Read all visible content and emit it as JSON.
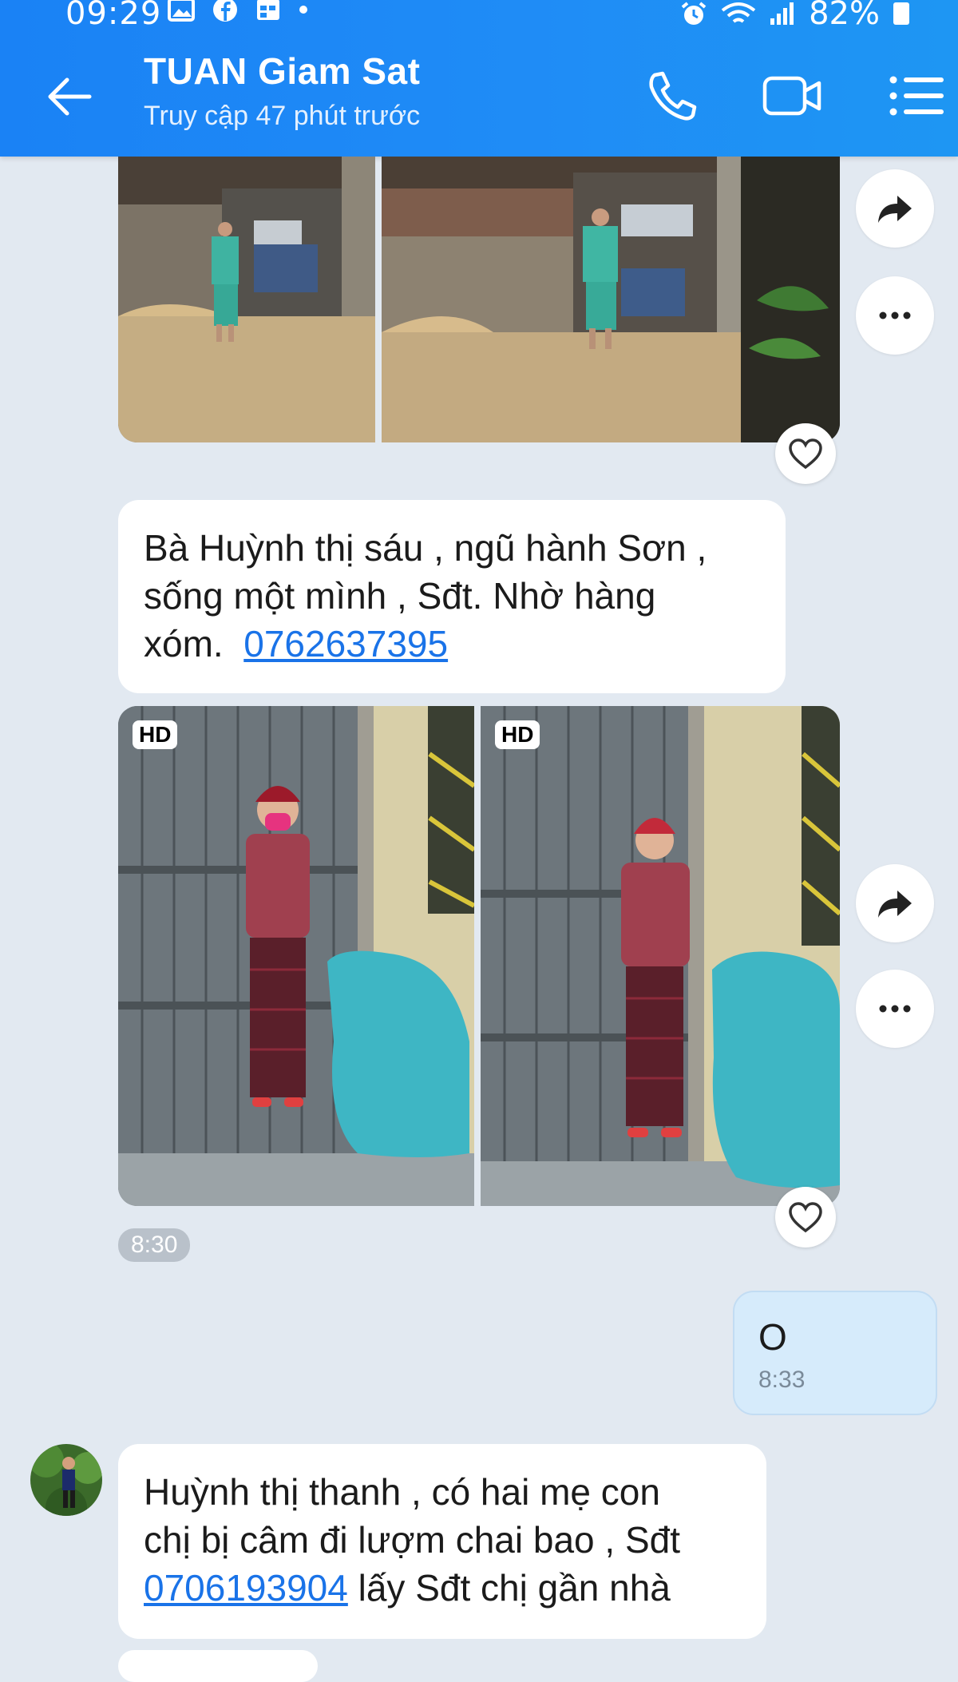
{
  "status_bar": {
    "time": "09:29",
    "battery": "82%"
  },
  "header": {
    "contact_name": "TUAN Giam Sat",
    "last_seen": "Truy cập 47 phút trước"
  },
  "messages": {
    "msg1": {
      "line1": "Bà Huỳnh thị sáu , ngũ hành Sơn  ,",
      "line2": "sống một mình , Sđt. Nhờ hàng",
      "line3_prefix": "xóm.  ",
      "phone": "0762637395"
    },
    "media2": {
      "hd_label_1": "HD",
      "hd_label_2": "HD",
      "time": "8:30"
    },
    "outgoing": {
      "text": "O",
      "time": "8:33"
    },
    "msg3": {
      "line1": "Huỳnh thị thanh , có hai mẹ con",
      "line2": "chị bị câm đi lượm chai bao , Sđt",
      "phone": "0706193904",
      "line3_suffix": " lấy Sđt chị gần nhà"
    }
  },
  "icons": {
    "back": "arrow-left-icon",
    "call": "phone-icon",
    "video": "video-camera-icon",
    "menu": "list-menu-icon",
    "share": "share-arrow-icon",
    "more": "more-dots-icon",
    "heart": "heart-icon"
  },
  "colors": {
    "header": "#1f8cf6",
    "background": "#e2e9f1",
    "link": "#1a73e8",
    "outgoing_bubble": "#d6ebfb"
  }
}
